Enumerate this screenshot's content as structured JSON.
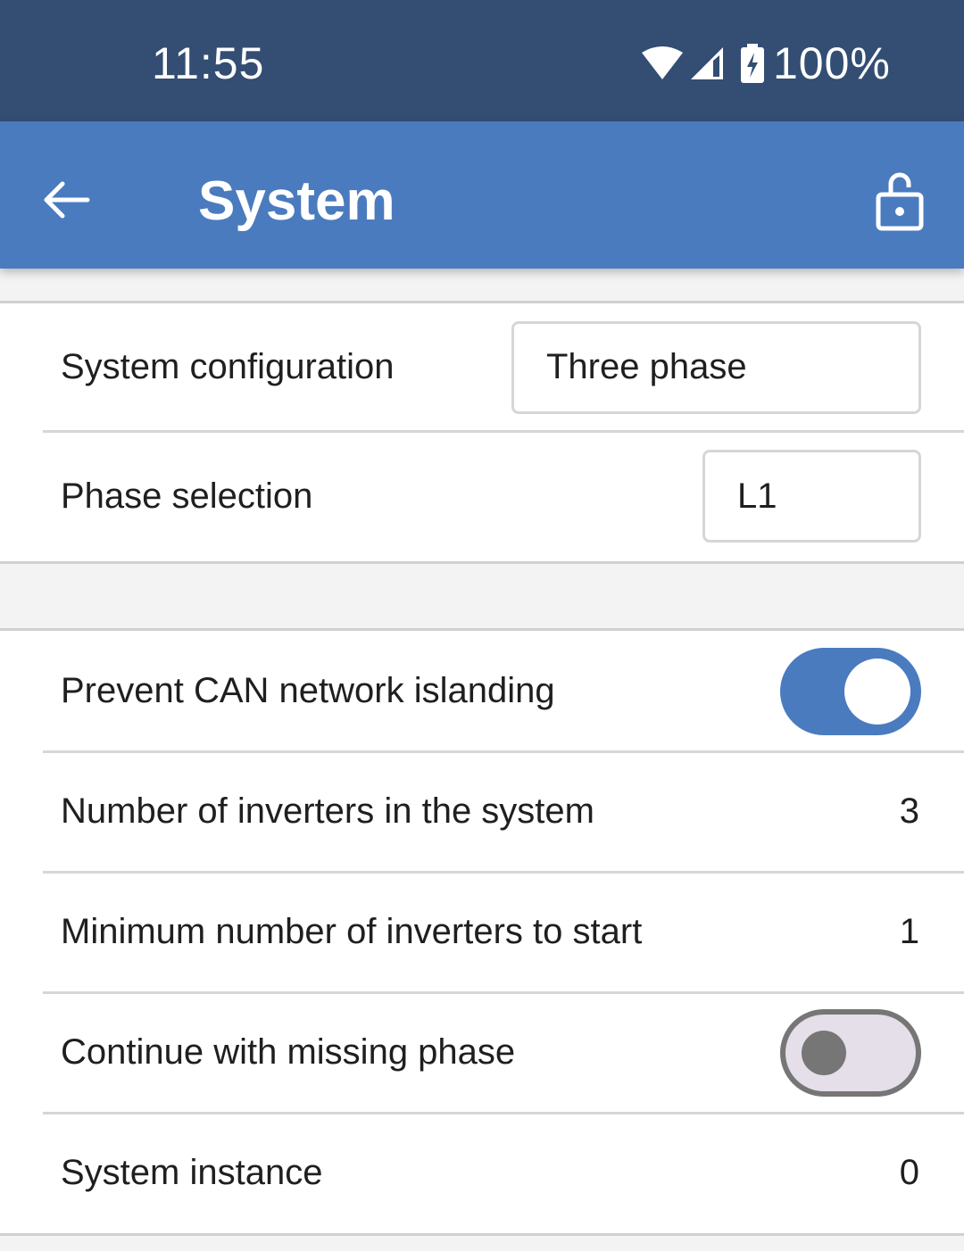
{
  "status_bar": {
    "time": "11:55",
    "battery_percent": "100%",
    "icons": [
      "wifi-icon",
      "cell-signal-icon",
      "battery-charging-icon"
    ]
  },
  "app_bar": {
    "title": "System",
    "back_icon": "arrow-left-icon",
    "lock_icon": "unlocked-padlock-icon"
  },
  "sections": [
    {
      "rows": [
        {
          "label": "System configuration",
          "type": "select",
          "value": "Three phase"
        },
        {
          "label": "Phase selection",
          "type": "select",
          "value": "L1"
        }
      ]
    },
    {
      "rows": [
        {
          "label": "Prevent CAN network islanding",
          "type": "toggle",
          "checked": true
        },
        {
          "label": "Number of inverters in the system",
          "type": "value",
          "value": "3"
        },
        {
          "label": "Minimum number of inverters to start",
          "type": "value",
          "value": "1"
        },
        {
          "label": "Continue with missing phase",
          "type": "toggle",
          "checked": false
        },
        {
          "label": "System instance",
          "type": "value",
          "value": "0"
        }
      ]
    }
  ],
  "colors": {
    "status_bar": "#334d73",
    "app_bar": "#4a7bbf",
    "toggle_on": "#4a7bbf",
    "toggle_off_track": "#e4dfe8",
    "toggle_off_border": "#767676",
    "background": "#f3f3f3",
    "divider": "#d6d6d6"
  }
}
